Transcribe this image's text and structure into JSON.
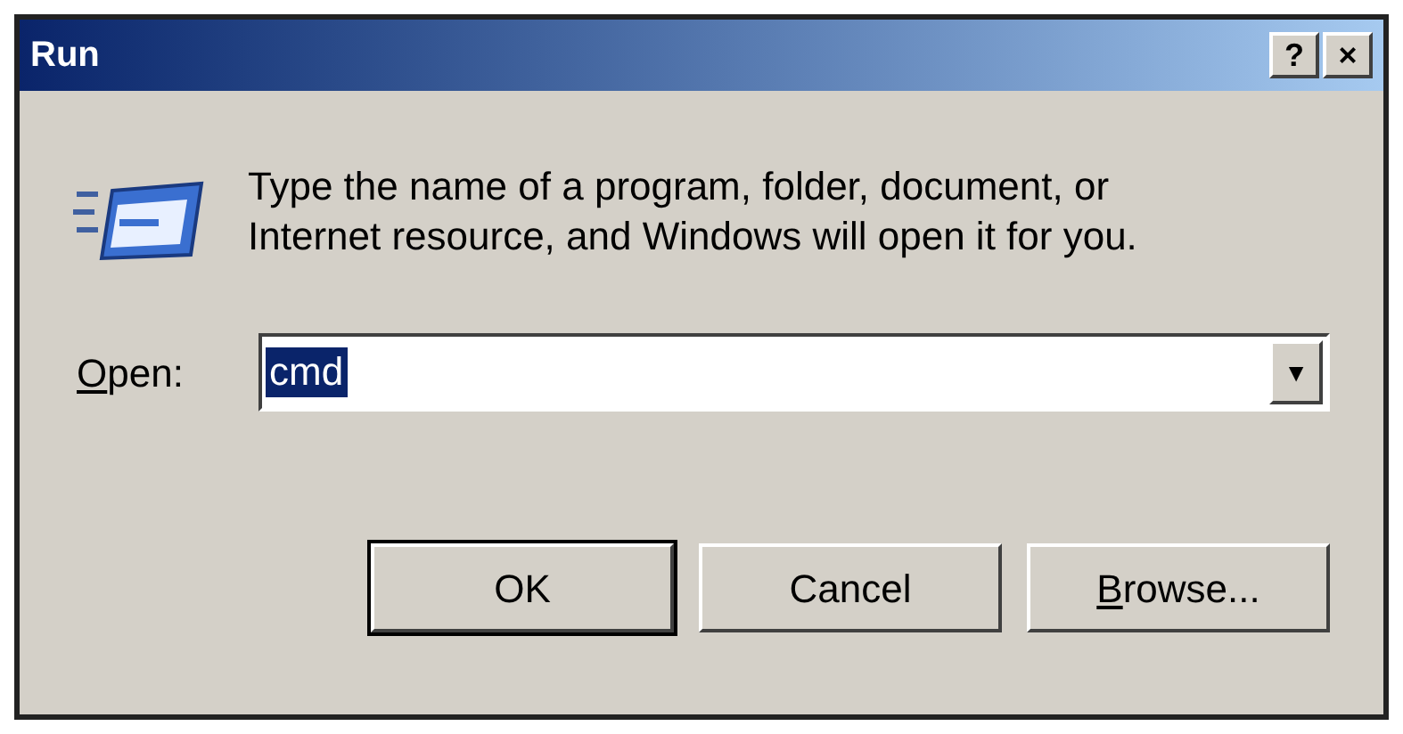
{
  "window": {
    "title": "Run",
    "title_buttons": [
      "?",
      "×"
    ]
  },
  "message": "Type the name of a program, folder, document, or Internet resource, and Windows will open it for you.",
  "open_field": {
    "label": [
      {
        "text": "O",
        "underlined": true
      },
      {
        "text": "pen:",
        "underlined": false
      }
    ],
    "value": "cmd",
    "value_selected": true,
    "dropdown_arrow": "▼"
  },
  "buttons": [
    {
      "label": [
        {
          "text": "OK",
          "underlined": false
        }
      ],
      "default": true
    },
    {
      "label": [
        {
          "text": "Cancel",
          "underlined": false
        }
      ],
      "default": false
    },
    {
      "label": [
        {
          "text": "B",
          "underlined": true
        },
        {
          "text": "rowse...",
          "underlined": false
        }
      ],
      "default": false
    }
  ]
}
